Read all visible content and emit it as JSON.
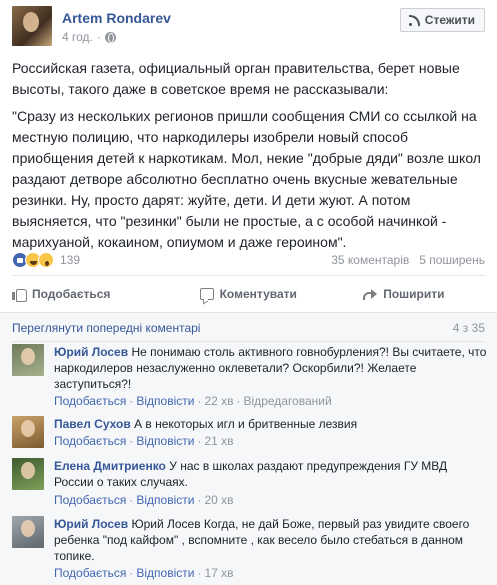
{
  "post": {
    "author": "Artem Rondarev",
    "time": "4 год.",
    "follow_label": "Стежити",
    "paragraphs": [
      "Российская газета, официальный орган правительства, берет новые высоты, такого даже в советское время не рассказывали:",
      "\"Сразу из нескольких регионов пришли сообщения СМИ со ссылкой на местную полицию, что наркодилеры изобрели новый способ приобщения детей к наркотикам. Мол, некие \"добрые дяди\" возле школ раздают детворе абсолютно бесплатно очень вкусные жевательные резинки. Ну, просто дарят: жуйте, дети. И дети жуют. А потом выясняется, что \"резинки\" были не простые, а с особой начинкой - марихуаной, кокаином, опиумом и даже героином\"."
    ],
    "reaction_count": "139",
    "comments_count": "35 коментарів",
    "shares_count": "5 поширень"
  },
  "actions": {
    "like": "Подобається",
    "comment": "Коментувати",
    "share": "Поширити"
  },
  "comments_section": {
    "previous_link": "Переглянути попередні коментарі",
    "page_count": "4 з 35",
    "like_label": "Подобається",
    "reply_label": "Відповісти",
    "sep": "·",
    "items": [
      {
        "name": "Юрий Лосев",
        "text": "Не понимаю столь активного говнобурления?! Вы считаете, что наркодилеров незаслуженно оклеветали? Оскорбили?! Желаете заступиться?!",
        "time": "22 хв",
        "edited": "Відредагований"
      },
      {
        "name": "Павел Сухов",
        "text": "А в некоторых игл и бритвенные лезвия",
        "time": "21 хв"
      },
      {
        "name": "Елена Дмитриенко",
        "text": "У нас в школах раздают предупреждения ГУ МВД России о таких случаях.",
        "time": "20 хв"
      },
      {
        "name": "Юрий Лосев",
        "text": "Юрий Лосев Когда, не дай Боже, первый раз увидите своего ребенка \"под кайфом\" , вспомните , как весело было стебаться в данном топике.",
        "time": "17 хв"
      }
    ]
  }
}
